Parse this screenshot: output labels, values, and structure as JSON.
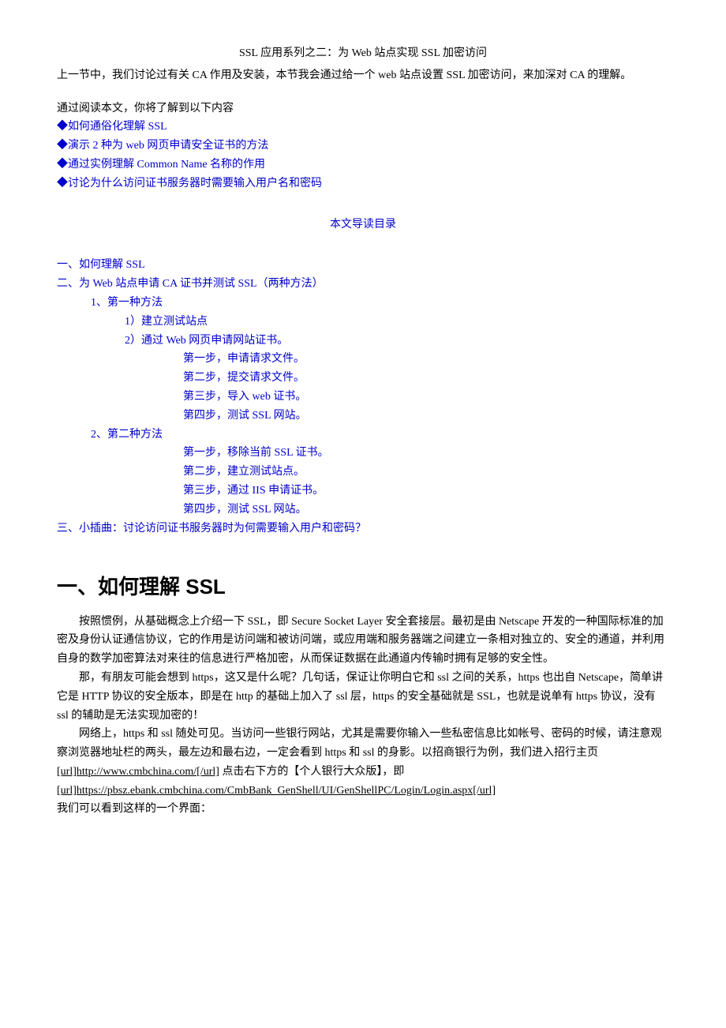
{
  "title": "SSL 应用系列之二：为 Web 站点实现 SSL 加密访问",
  "intro": "上一节中，我们讨论过有关 CA 作用及安装，本节我会通过给一个 web 站点设置 SSL 加密访问，来加深对 CA 的理解。",
  "understand_lead": "通过阅读本文，你将了解到以下内容",
  "bullets": {
    "b1": "◆如何通俗化理解 SSL",
    "b2": "◆演示 2 种为 web 网页申请安全证书的方法",
    "b3": "◆通过实例理解 Common Name 名称的作用",
    "b4": "◆讨论为什么访问证书服务器时需要输入用户名和密码"
  },
  "toc_title": "本文导读目录",
  "toc": {
    "l1": "一、如何理解 SSL",
    "l2": "二、为 Web 站点申请 CA 证书并测试 SSL（两种方法）",
    "l2_1": "1、第一种方法",
    "l2_1_a": "1）建立测试站点",
    "l2_1_b": "2）通过 Web 网页申请网站证书。",
    "l2_1_b_s1": "第一步，申请请求文件。",
    "l2_1_b_s2": "第二步，提交请求文件。",
    "l2_1_b_s3": "第三步，导入 web 证书。",
    "l2_1_b_s4": "第四步，测试 SSL 网站。",
    "l2_2": "2、第二种方法",
    "l2_2_s1": "第一步，移除当前 SSL 证书。",
    "l2_2_s2": "第二步，建立测试站点。",
    "l2_2_s3": "第三步，通过 IIS 申请证书。",
    "l2_2_s4": "第四步，测试 SSL 网站。",
    "l3": "三、小插曲：讨论访问证书服务器时为何需要输入用户和密码？"
  },
  "section1_heading_cn": "一、如何理解 ",
  "section1_heading_en": "SSL",
  "body": {
    "p1": "按照惯例，从基础概念上介绍一下 SSL，即 Secure Socket Layer 安全套接层。最初是由 Netscape 开发的一种国际标准的加密及身份认证通信协议，它的作用是访问端和被访问端，或应用端和服务器端之间建立一条相对独立的、安全的通道，并利用自身的数学加密算法对来往的信息进行严格加密，从而保证数据在此通道内传输时拥有足够的安全性。",
    "p2": "那，有朋友可能会想到 https，这又是什么呢？几句话，保证让你明白它和 ssl 之间的关系，https 也出自 Netscape，简单讲它是 HTTP 协议的安全版本，即是在 http 的基础上加入了 ssl 层，https 的安全基础就是 SSL，也就是说单有 https 协议，没有 ssl 的辅助是无法实现加密的！",
    "p3_pre": "网络上，https 和 ssl 随处可见。当访问一些银行网站，尤其是需要你输入一些私密信息比如帐号、密码的时候，请注意观察浏览器地址栏的两头，最左边和最右边，一定会看到 https 和 ssl 的身影。以招商银行为例，我们进入招行主页",
    "link1": "[url]http://www.cmbchina.com/[/url]",
    "p3_mid": " 点击右下方的【个人银行大众版】，即",
    "link2": "[url]https://pbsz.ebank.cmbchina.com/CmbBank_GenShell/UI/GenShellPC/Login/Login.aspx[/url]",
    "p4": "我们可以看到这样的一个界面："
  }
}
